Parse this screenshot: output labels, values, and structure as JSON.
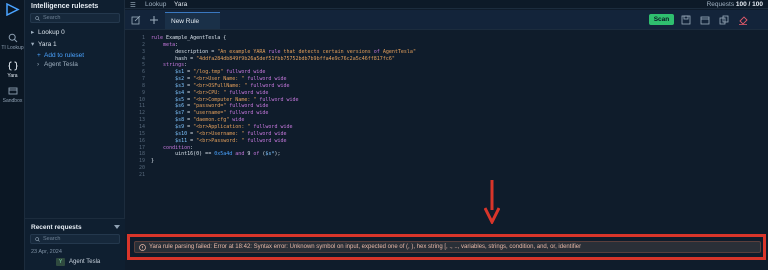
{
  "topbar": {
    "tabs": [
      "Lookup",
      "Yara"
    ],
    "requests_label": "Requests",
    "requests_value": "100 / 100"
  },
  "rail": {
    "items": [
      {
        "label": "TI Lookup",
        "icon": "ti-lookup-icon"
      },
      {
        "label": "Yara",
        "icon": "yara-icon"
      },
      {
        "label": "Sandbox",
        "icon": "sandbox-icon"
      }
    ]
  },
  "sidebar": {
    "title": "Intelligence rulesets",
    "search_placeholder": "Search",
    "tree": [
      {
        "label": "Lookup 0",
        "caret": "▸"
      },
      {
        "label": "Yara 1",
        "caret": "▾"
      },
      {
        "label": "Add to ruleset",
        "caret": "+"
      },
      {
        "label": "Agent Tesla",
        "caret": "›"
      }
    ]
  },
  "recent": {
    "title": "Recent requests",
    "search_placeholder": "Search",
    "date": "23 Apr, 2024",
    "item_badge": "Y",
    "item_label": "Agent Tesla"
  },
  "editor": {
    "tab_label": "New Rule",
    "scan_label": "Scan",
    "line_numbers": [
      "1",
      "2",
      "3",
      "4",
      "5",
      "6",
      "7",
      "8",
      "9",
      "10",
      "11",
      "12",
      "13",
      "14",
      "15",
      "16",
      "17",
      "18",
      "19",
      "20",
      "21"
    ],
    "lines": [
      "rule Example_AgentTesla {",
      "    meta:",
      "        description = \"An example YARA rule that detects certain versions of AgentTesla\"",
      "        hash = \"4ddfa284db849f9b26a5def51fbb75752bdb7b9bffa4e9c76c2a5c46ff817fc6\"",
      "    strings:",
      "        $s1 = \"/log.tmp\" fullword wide",
      "        $s2 = \"<br>User Name: \" fullword wide",
      "        $s3 = \"<br>OSFullName: \" fullword wide",
      "        $s4 = \"<br>CPU: \" fullword wide",
      "        $s5 = \"<br>Computer Name: \" fullword wide",
      "        $s6 = \"password=\" fullword wide",
      "        $s7 = \"username=\" fullword wide",
      "        $s8 = \"daemon.cfg\" wide",
      "        $s9 = \"<br>Application: \" fullword wide",
      "        $s10 = \"<br>Username: \" fullword wide",
      "        $s11 = \"<br>Password: \" fullword wide",
      "    condition:",
      "        uint16(0) == 0x5a4d and 9 of ($s*);",
      "}",
      "",
      ""
    ]
  },
  "error": {
    "message": "Yara rule parsing failed: Error at 18:42: Syntax error: Unknown symbol on input, expected one of (, ), hex string [, ., .., variables, strings, condition, and, or, identifier"
  },
  "colors": {
    "accent": "#2fbf6f",
    "error_outline": "#d8352a",
    "link": "#4aa3ff"
  }
}
